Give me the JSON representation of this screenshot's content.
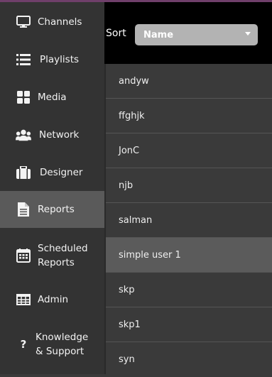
{
  "nav": {
    "items": [
      {
        "icon": "monitor-icon",
        "label": "Channels"
      },
      {
        "icon": "list-icon",
        "label": "Playlists"
      },
      {
        "icon": "grid-icon",
        "label": "Media"
      },
      {
        "icon": "users-icon",
        "label": "Network"
      },
      {
        "icon": "briefcase-icon",
        "label": "Designer"
      },
      {
        "icon": "document-icon",
        "label": "Reports",
        "active": true
      },
      {
        "icon": "calendar-icon",
        "label": "Scheduled Reports"
      },
      {
        "icon": "table-icon",
        "label": "Admin"
      },
      {
        "icon": "question-icon",
        "label": "Knowledge & Support"
      }
    ]
  },
  "sort": {
    "label": "Sort",
    "value": "Name"
  },
  "users": {
    "items": [
      "andyw",
      "ffghjk",
      "JonC",
      "njb",
      "salman",
      "simple user 1",
      "skp",
      "skp1",
      "syn"
    ],
    "selected": "simple user 1"
  },
  "colors": {
    "sidebar": "#333333",
    "active": "#5a5a5a",
    "list": "#3a3a3a",
    "header": "#000000",
    "select": "#b3b3b3"
  }
}
